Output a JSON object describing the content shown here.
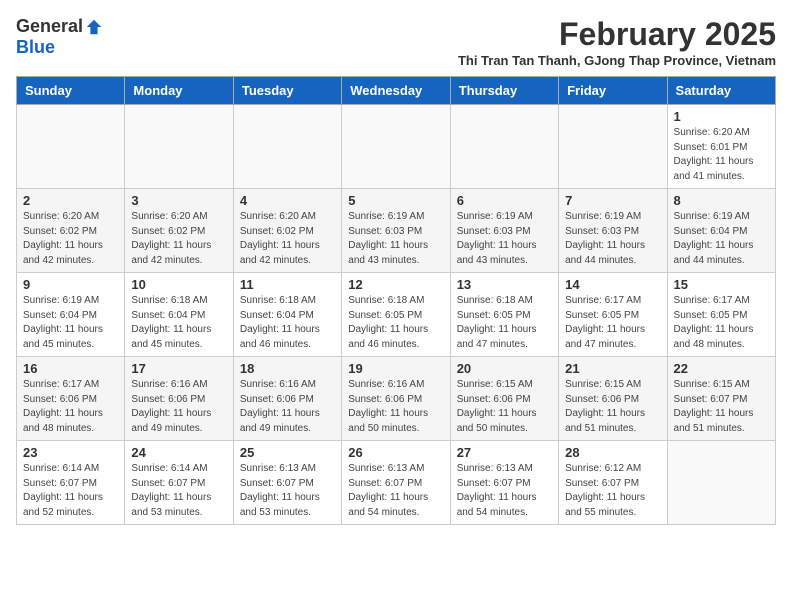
{
  "header": {
    "logo": {
      "general": "General",
      "blue": "Blue",
      "tagline": ""
    },
    "title": "February 2025",
    "subtitle": "Thi Tran Tan Thanh, GJong Thap Province, Vietnam"
  },
  "weekdays": [
    "Sunday",
    "Monday",
    "Tuesday",
    "Wednesday",
    "Thursday",
    "Friday",
    "Saturday"
  ],
  "weeks": [
    [
      {
        "day": "",
        "info": ""
      },
      {
        "day": "",
        "info": ""
      },
      {
        "day": "",
        "info": ""
      },
      {
        "day": "",
        "info": ""
      },
      {
        "day": "",
        "info": ""
      },
      {
        "day": "",
        "info": ""
      },
      {
        "day": "1",
        "info": "Sunrise: 6:20 AM\nSunset: 6:01 PM\nDaylight: 11 hours\nand 41 minutes."
      }
    ],
    [
      {
        "day": "2",
        "info": "Sunrise: 6:20 AM\nSunset: 6:02 PM\nDaylight: 11 hours\nand 42 minutes."
      },
      {
        "day": "3",
        "info": "Sunrise: 6:20 AM\nSunset: 6:02 PM\nDaylight: 11 hours\nand 42 minutes."
      },
      {
        "day": "4",
        "info": "Sunrise: 6:20 AM\nSunset: 6:02 PM\nDaylight: 11 hours\nand 42 minutes."
      },
      {
        "day": "5",
        "info": "Sunrise: 6:19 AM\nSunset: 6:03 PM\nDaylight: 11 hours\nand 43 minutes."
      },
      {
        "day": "6",
        "info": "Sunrise: 6:19 AM\nSunset: 6:03 PM\nDaylight: 11 hours\nand 43 minutes."
      },
      {
        "day": "7",
        "info": "Sunrise: 6:19 AM\nSunset: 6:03 PM\nDaylight: 11 hours\nand 44 minutes."
      },
      {
        "day": "8",
        "info": "Sunrise: 6:19 AM\nSunset: 6:04 PM\nDaylight: 11 hours\nand 44 minutes."
      }
    ],
    [
      {
        "day": "9",
        "info": "Sunrise: 6:19 AM\nSunset: 6:04 PM\nDaylight: 11 hours\nand 45 minutes."
      },
      {
        "day": "10",
        "info": "Sunrise: 6:18 AM\nSunset: 6:04 PM\nDaylight: 11 hours\nand 45 minutes."
      },
      {
        "day": "11",
        "info": "Sunrise: 6:18 AM\nSunset: 6:04 PM\nDaylight: 11 hours\nand 46 minutes."
      },
      {
        "day": "12",
        "info": "Sunrise: 6:18 AM\nSunset: 6:05 PM\nDaylight: 11 hours\nand 46 minutes."
      },
      {
        "day": "13",
        "info": "Sunrise: 6:18 AM\nSunset: 6:05 PM\nDaylight: 11 hours\nand 47 minutes."
      },
      {
        "day": "14",
        "info": "Sunrise: 6:17 AM\nSunset: 6:05 PM\nDaylight: 11 hours\nand 47 minutes."
      },
      {
        "day": "15",
        "info": "Sunrise: 6:17 AM\nSunset: 6:05 PM\nDaylight: 11 hours\nand 48 minutes."
      }
    ],
    [
      {
        "day": "16",
        "info": "Sunrise: 6:17 AM\nSunset: 6:06 PM\nDaylight: 11 hours\nand 48 minutes."
      },
      {
        "day": "17",
        "info": "Sunrise: 6:16 AM\nSunset: 6:06 PM\nDaylight: 11 hours\nand 49 minutes."
      },
      {
        "day": "18",
        "info": "Sunrise: 6:16 AM\nSunset: 6:06 PM\nDaylight: 11 hours\nand 49 minutes."
      },
      {
        "day": "19",
        "info": "Sunrise: 6:16 AM\nSunset: 6:06 PM\nDaylight: 11 hours\nand 50 minutes."
      },
      {
        "day": "20",
        "info": "Sunrise: 6:15 AM\nSunset: 6:06 PM\nDaylight: 11 hours\nand 50 minutes."
      },
      {
        "day": "21",
        "info": "Sunrise: 6:15 AM\nSunset: 6:06 PM\nDaylight: 11 hours\nand 51 minutes."
      },
      {
        "day": "22",
        "info": "Sunrise: 6:15 AM\nSunset: 6:07 PM\nDaylight: 11 hours\nand 51 minutes."
      }
    ],
    [
      {
        "day": "23",
        "info": "Sunrise: 6:14 AM\nSunset: 6:07 PM\nDaylight: 11 hours\nand 52 minutes."
      },
      {
        "day": "24",
        "info": "Sunrise: 6:14 AM\nSunset: 6:07 PM\nDaylight: 11 hours\nand 53 minutes."
      },
      {
        "day": "25",
        "info": "Sunrise: 6:13 AM\nSunset: 6:07 PM\nDaylight: 11 hours\nand 53 minutes."
      },
      {
        "day": "26",
        "info": "Sunrise: 6:13 AM\nSunset: 6:07 PM\nDaylight: 11 hours\nand 54 minutes."
      },
      {
        "day": "27",
        "info": "Sunrise: 6:13 AM\nSunset: 6:07 PM\nDaylight: 11 hours\nand 54 minutes."
      },
      {
        "day": "28",
        "info": "Sunrise: 6:12 AM\nSunset: 6:07 PM\nDaylight: 11 hours\nand 55 minutes."
      },
      {
        "day": "",
        "info": ""
      }
    ]
  ]
}
